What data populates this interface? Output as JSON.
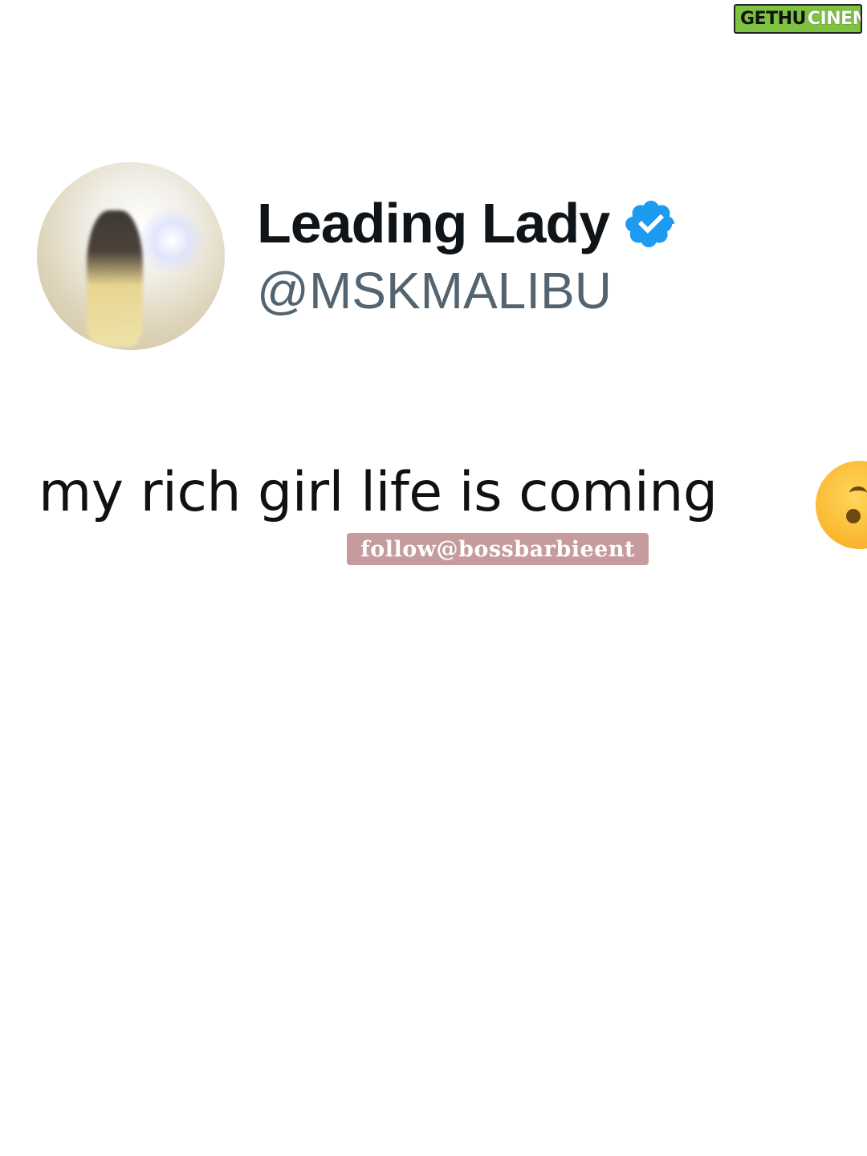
{
  "watermark": {
    "part1": "GETHU",
    "part2": "CINEMA"
  },
  "tweet": {
    "display_name": "Leading Lady",
    "handle": "@MSKMALIBU",
    "verified": true,
    "verified_color": "#1d9bf0",
    "text": "my rich girl life is coming",
    "emoji": "face-with-hand-over-mouth-emoji"
  },
  "overlay": {
    "follow_tag": "follow@bossbarbieent",
    "follow_tag_color": "#c59b9d"
  }
}
